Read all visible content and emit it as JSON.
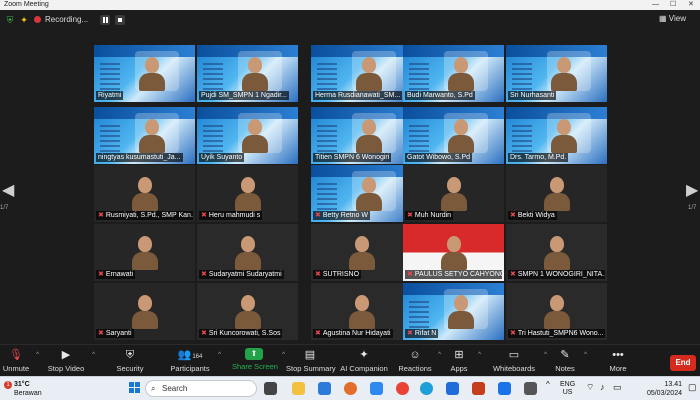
{
  "window": {
    "title": "Zoom Meeting",
    "controls": [
      "—",
      "☐",
      "✕"
    ]
  },
  "top_bar": {
    "recording_label": "Recording...",
    "view_label": "View"
  },
  "pages": {
    "left": "1/7",
    "right": "1/7"
  },
  "participants": [
    {
      "name": "Riyatmi",
      "muted": false,
      "type": "slide"
    },
    {
      "name": "Pujdi SM_SMPN 1 Ngadir...",
      "muted": false,
      "type": "slide"
    },
    {
      "name": "Herma Rusdianawati_SM...",
      "muted": false,
      "type": "slide"
    },
    {
      "name": "Budi Marwanto, S.Pd",
      "muted": false,
      "type": "slide"
    },
    {
      "name": "Sri Nurhasanti",
      "muted": false,
      "type": "slide"
    },
    {
      "name": "ningtyas kusumastuti_Ja...",
      "muted": false,
      "type": "slide"
    },
    {
      "name": "Uyik Suyanto",
      "muted": false,
      "type": "slide"
    },
    {
      "name": "Titien SMPN 6 Wonogiri",
      "muted": false,
      "type": "slide"
    },
    {
      "name": "Gatot Wibowo, S.Pd",
      "muted": false,
      "type": "slide"
    },
    {
      "name": "Drs. Tarmo, M.Pd.",
      "muted": false,
      "type": "slide"
    },
    {
      "name": "Rusmiyati, S.Pd., SMP Kan...",
      "muted": true,
      "type": "blank"
    },
    {
      "name": "Heru mahmudi s",
      "muted": true,
      "type": "blank"
    },
    {
      "name": "Betty Retno W",
      "muted": true,
      "type": "slide"
    },
    {
      "name": "Muh Nurdin",
      "muted": true,
      "type": "blank"
    },
    {
      "name": "Bekti Widya",
      "muted": true,
      "type": "blank"
    },
    {
      "name": "Ernawati",
      "muted": true,
      "type": "blank"
    },
    {
      "name": "Sudaryatmi Sudaryatmi",
      "muted": true,
      "type": "room"
    },
    {
      "name": "SUTRISNO",
      "muted": true,
      "type": "room"
    },
    {
      "name": "PAULUS SETYO CAHYONO",
      "muted": true,
      "type": "flag"
    },
    {
      "name": "SMPN 1 WONOGIRI_NITA...",
      "muted": true,
      "type": "room"
    },
    {
      "name": "Saryanti",
      "muted": true,
      "type": "blank"
    },
    {
      "name": "Sri Kuncorowati, S.Sos",
      "muted": true,
      "type": "room"
    },
    {
      "name": "Agustina Nur Hidayati",
      "muted": true,
      "type": "room"
    },
    {
      "name": "Rifat N",
      "muted": true,
      "type": "slide"
    },
    {
      "name": "Tri Hastuti_SMPN6 Wono...",
      "muted": true,
      "type": "room"
    }
  ],
  "toolbar": {
    "unmute": "Unmute",
    "stop_video": "Stop Video",
    "security": "Security",
    "participants": "Participants",
    "participants_count": "164",
    "share_screen": "Share Screen",
    "stop_summary": "Stop Summary",
    "ai_companion": "AI Companion",
    "reactions": "Reactions",
    "apps": "Apps",
    "whiteboards": "Whiteboards",
    "notes": "Notes",
    "more": "More",
    "end": "End"
  },
  "taskbar": {
    "notification_count": "1",
    "temperature": "31°C",
    "weather": "Berawan",
    "search_placeholder": "Search",
    "language": "ENG",
    "region": "US",
    "time": "13.41",
    "date": "05/03/2024"
  },
  "colors": {
    "accent_green": "#22b34e",
    "end_red": "#d52b1e",
    "muted_red": "#e5484d"
  }
}
